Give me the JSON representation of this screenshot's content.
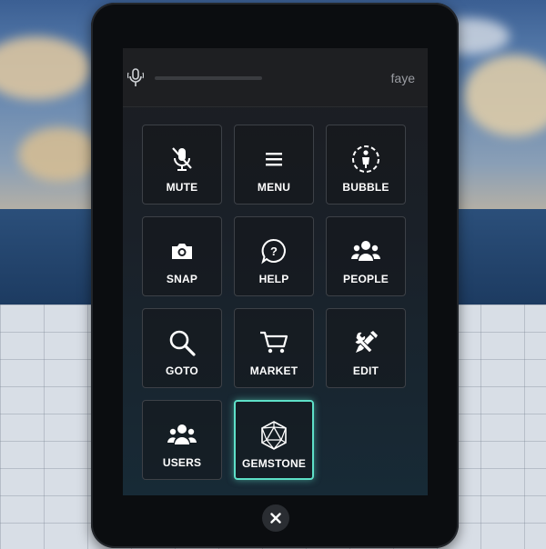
{
  "header": {
    "username": "faye"
  },
  "tiles": [
    {
      "label": "MUTE",
      "icon": "mute-icon"
    },
    {
      "label": "MENU",
      "icon": "menu-icon"
    },
    {
      "label": "BUBBLE",
      "icon": "bubble-icon"
    },
    {
      "label": "SNAP",
      "icon": "camera-icon"
    },
    {
      "label": "HELP",
      "icon": "help-icon"
    },
    {
      "label": "PEOPLE",
      "icon": "people-icon"
    },
    {
      "label": "GOTO",
      "icon": "search-icon"
    },
    {
      "label": "MARKET",
      "icon": "cart-icon"
    },
    {
      "label": "EDIT",
      "icon": "edit-tools-icon"
    },
    {
      "label": "USERS",
      "icon": "users-icon"
    },
    {
      "label": "GEMSTONE",
      "icon": "gemstone-icon"
    }
  ],
  "colors": {
    "active_border": "#5ee0c8",
    "tile_border": "#3d4147",
    "label": "#ffffff"
  },
  "active_tile": "GEMSTONE"
}
